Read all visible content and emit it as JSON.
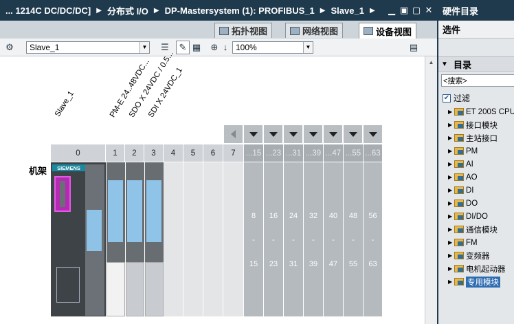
{
  "titlebar": {
    "crumbs": [
      "... 1214C DC/DC/DC]",
      "分布式 I/O",
      "DP-Mastersystem (1): PROFIBUS_1",
      "Slave_1"
    ],
    "btn_min": "▁",
    "btn_restore": "▣",
    "btn_max": "▢",
    "btn_close": "✕"
  },
  "tabs": [
    {
      "label": "拓扑视图",
      "active": false
    },
    {
      "label": "网络视图",
      "active": false
    },
    {
      "label": "设备视图",
      "active": true
    }
  ],
  "toolbar": {
    "device_select": "Slave_1",
    "zoom": "100%"
  },
  "modules": {
    "labels": [
      "Slave_1",
      "PM-E 24..48VDC...",
      "SDO X 24VDC / 0.5...",
      "SDI X 24VDC_1"
    ]
  },
  "rack": {
    "label": "机架",
    "cpu_brand": "SIEMENS",
    "slots": [
      "0",
      "1",
      "2",
      "3",
      "4",
      "5",
      "6",
      "7"
    ],
    "group_headers": [
      "...15",
      "...23",
      "...31",
      "...39",
      "...47",
      "...55",
      "...63"
    ],
    "group_start": [
      "8",
      "16",
      "24",
      "32",
      "40",
      "48",
      "56"
    ],
    "group_dash": "-",
    "group_end": [
      "15",
      "23",
      "31",
      "39",
      "47",
      "55",
      "63"
    ]
  },
  "catalog": {
    "title": "硬件目录",
    "options": "选件",
    "section": "目录",
    "search_placeholder": "<搜索>",
    "filter_label": "过滤",
    "items": [
      "ET 200S CPU",
      "接口模块",
      "主站接口",
      "PM",
      "AI",
      "AO",
      "DI",
      "DO",
      "DI/DO",
      "通信模块",
      "FM",
      "变频器",
      "电机起动器",
      "专用模块"
    ],
    "selected": "专用模块"
  }
}
